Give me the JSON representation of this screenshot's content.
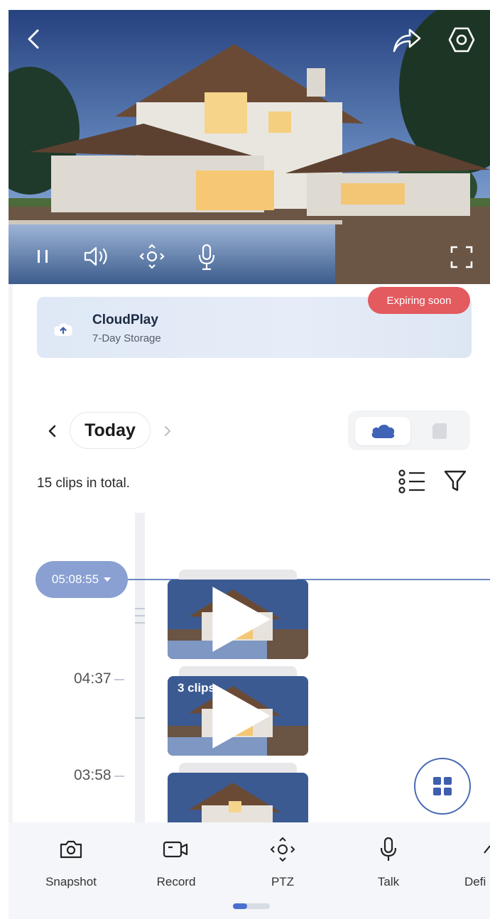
{
  "video": {
    "controls": [
      "back-icon",
      "share-icon",
      "settings-icon",
      "pause-icon",
      "volume-icon",
      "ptz-icon",
      "mic-icon",
      "fullscreen-icon"
    ]
  },
  "cloud": {
    "title": "CloudPlay",
    "subtitle": "7-Day Storage",
    "badge": "Expiring soon",
    "badge_color": "#e35a5f"
  },
  "date": {
    "label": "Today"
  },
  "clips": {
    "total_text": "15 clips in total.",
    "current_time": "05:08:55",
    "times": [
      "04:37",
      "03:58"
    ],
    "group_label": "3 clips"
  },
  "toolbar": {
    "items": [
      {
        "label": "Snapshot",
        "icon": "camera-icon"
      },
      {
        "label": "Record",
        "icon": "video-record-icon"
      },
      {
        "label": "PTZ",
        "icon": "ptz-icon"
      },
      {
        "label": "Talk",
        "icon": "mic-icon"
      },
      {
        "label": "Defi",
        "icon": "definition-icon"
      }
    ]
  },
  "colors": {
    "accent": "#4668b4",
    "now_pill": "#8aa0d2"
  }
}
